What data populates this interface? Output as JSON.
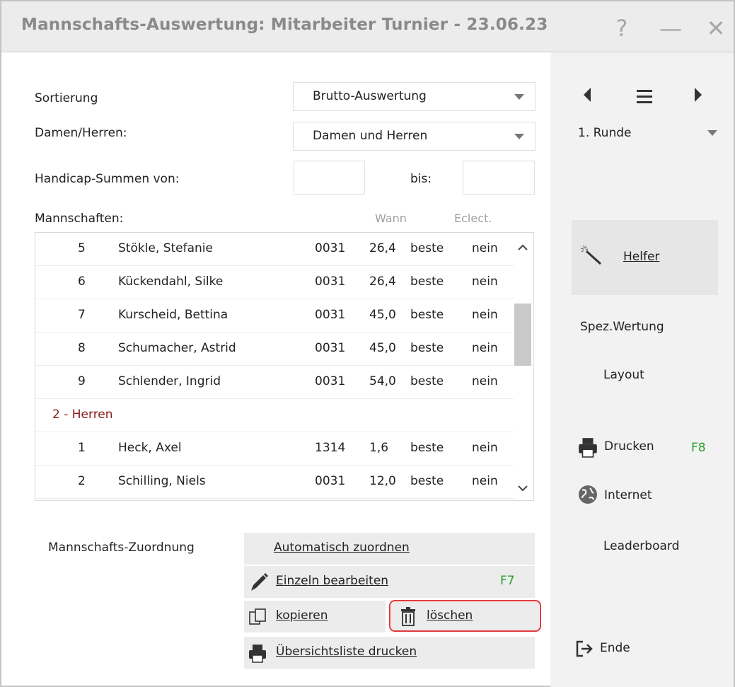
{
  "window": {
    "title": "Mannschafts-Auswertung: Mitarbeiter Turnier - 23.06.23"
  },
  "titlebar_buttons": {
    "help": "?",
    "minimize": "—",
    "close": "✕"
  },
  "form": {
    "sort_label": "Sortierung",
    "sort_value": "Brutto-Auswertung",
    "gender_label": "Damen/Herren:",
    "gender_value": "Damen und Herren",
    "hcp_label": "Handicap-Summen von:",
    "hcp_from": "",
    "hcp_to_label": "bis:",
    "hcp_to": "",
    "teams_label": "Mannschaften:",
    "col_when": "Wann",
    "col_eclect": "Eclect."
  },
  "rows": [
    {
      "nr": "5",
      "name": "Stökle, Stefanie",
      "club": "0031",
      "hcp": "26,4",
      "when": "beste",
      "eclect": "nein"
    },
    {
      "nr": "6",
      "name": "Kückendahl, Silke",
      "club": "0031",
      "hcp": "26,4",
      "when": "beste",
      "eclect": "nein"
    },
    {
      "nr": "7",
      "name": "Kurscheid, Bettina",
      "club": "0031",
      "hcp": "45,0",
      "when": "beste",
      "eclect": "nein"
    },
    {
      "nr": "8",
      "name": "Schumacher, Astrid",
      "club": "0031",
      "hcp": "45,0",
      "when": "beste",
      "eclect": "nein"
    },
    {
      "nr": "9",
      "name": "Schlender, Ingrid",
      "club": "0031",
      "hcp": "54,0",
      "when": "beste",
      "eclect": "nein"
    },
    {
      "group": "2 - Herren"
    },
    {
      "nr": "1",
      "name": "Heck, Axel",
      "club": "1314",
      "hcp": "1,6",
      "when": "beste",
      "eclect": "nein"
    },
    {
      "nr": "2",
      "name": "Schilling, Niels",
      "club": "0031",
      "hcp": "12,0",
      "when": "beste",
      "eclect": "nein"
    }
  ],
  "assign": {
    "label": "Mannschafts-Zuordnung",
    "auto_label": "Automatisch zuordnen",
    "edit_label": "Einzeln bearbeiten",
    "edit_hotkey": "F7",
    "copy_label": "kopieren",
    "delete_label": "löschen",
    "print_list_label": "Übersichtsliste drucken"
  },
  "sidebar": {
    "round_value": "1. Runde",
    "helper_label": "Helfer",
    "special_label": "Spez.Wertung",
    "layout_label": "Layout",
    "print_label": "Drucken",
    "print_hotkey": "F8",
    "internet_label": "Internet",
    "leaderboard_label": "Leaderboard",
    "end_label": "Ende"
  }
}
